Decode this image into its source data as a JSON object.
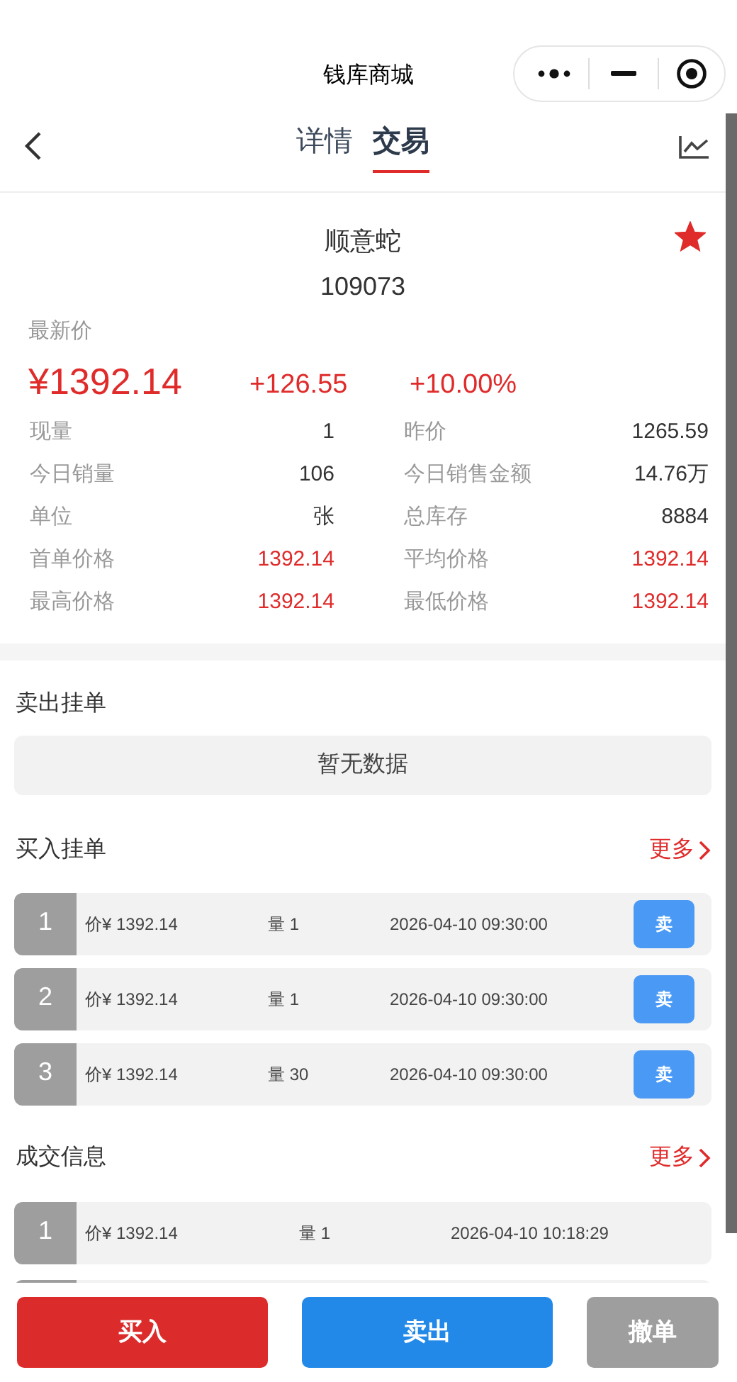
{
  "header": {
    "title": "钱库商城"
  },
  "tabs": [
    {
      "label": "详情",
      "selected": false
    },
    {
      "label": "交易",
      "selected": true
    }
  ],
  "product": {
    "name": "顺意蛇",
    "code": "109073",
    "favorite": true
  },
  "latest": {
    "label": "最新价",
    "price": "¥1392.14",
    "change": "+126.55",
    "change_pct": "+10.00%"
  },
  "stats": [
    {
      "label": "现量",
      "value": "1",
      "highlight": false
    },
    {
      "label": "昨价",
      "value": "1265.59",
      "highlight": false
    },
    {
      "label": "今日销量",
      "value": "106",
      "highlight": false
    },
    {
      "label": "今日销售金额",
      "value": "14.76万",
      "highlight": false
    },
    {
      "label": "单位",
      "value": "张",
      "highlight": false
    },
    {
      "label": "总库存",
      "value": "8884",
      "highlight": false
    },
    {
      "label": "首单价格",
      "value": "1392.14",
      "highlight": true
    },
    {
      "label": "平均价格",
      "value": "1392.14",
      "highlight": true
    },
    {
      "label": "最高价格",
      "value": "1392.14",
      "highlight": true
    },
    {
      "label": "最低价格",
      "value": "1392.14",
      "highlight": true
    }
  ],
  "sell_orders": {
    "title": "卖出挂单",
    "empty_text": "暂无数据"
  },
  "buy_orders": {
    "title": "买入挂单",
    "more": "更多",
    "rows": [
      {
        "index": "1",
        "price": "价¥ 1392.14",
        "qty": "量 1",
        "time": "2026-04-10 09:30:00",
        "action": "卖"
      },
      {
        "index": "2",
        "price": "价¥ 1392.14",
        "qty": "量 1",
        "time": "2026-04-10 09:30:00",
        "action": "卖"
      },
      {
        "index": "3",
        "price": "价¥ 1392.14",
        "qty": "量 30",
        "time": "2026-04-10 09:30:00",
        "action": "卖"
      }
    ]
  },
  "trades": {
    "title": "成交信息",
    "more": "更多",
    "rows": [
      {
        "index": "1",
        "price": "价¥ 1392.14",
        "qty": "量 1",
        "time": "2026-04-10 10:18:29"
      }
    ]
  },
  "actions": [
    {
      "label": "买入",
      "kind": "buy"
    },
    {
      "label": "卖出",
      "kind": "sell"
    },
    {
      "label": "撤单",
      "kind": "cancel"
    }
  ]
}
